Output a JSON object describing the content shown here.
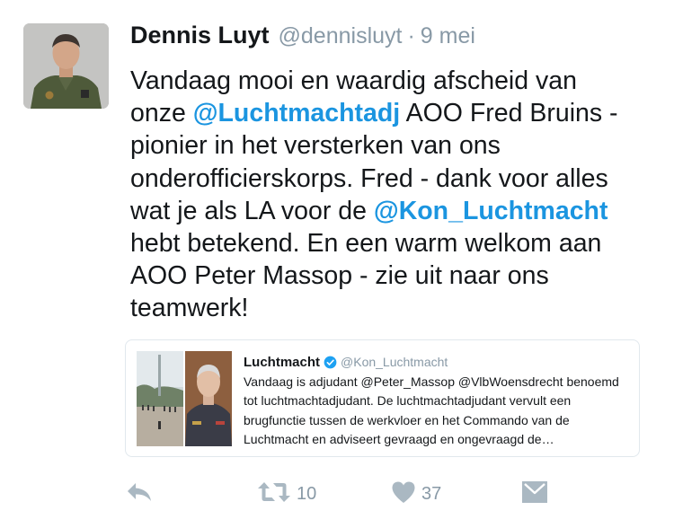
{
  "tweet": {
    "author_name": "Dennis Luyt",
    "author_handle": "@dennisluyt",
    "separator": "·",
    "time": "9 mei",
    "text_lines": [
      [
        {
          "t": "Vandaag mooi en waardig afscheid van"
        }
      ],
      [
        {
          "t": "onze "
        },
        {
          "t": "@Luchtmachtadj",
          "mention": true
        },
        {
          "t": " AOO Fred Bruins -"
        }
      ],
      [
        {
          "t": "pionier in het versterken van ons"
        }
      ],
      [
        {
          "t": "onderofficierskorps. Fred - dank voor alles"
        }
      ],
      [
        {
          "t": "wat je als LA voor de "
        },
        {
          "t": "@Kon_Luchtmacht",
          "mention": true
        }
      ],
      [
        {
          "t": "hebt betekend. En een warm welkom aan"
        }
      ],
      [
        {
          "t": "AOO Peter Massop - zie uit naar ons"
        }
      ],
      [
        {
          "t": "teamwerk!"
        }
      ]
    ],
    "mention_color": "#1b95e0"
  },
  "quoted_tweet": {
    "author_name": "Luchtmacht",
    "author_handle": "@Kon_Luchtmacht",
    "verified_icon": "verified-badge-icon",
    "text_lines": [
      "Vandaag is adjudant @Peter_Massop @VlbWoensdrecht benoemd",
      "tot luchtmachtadjudant. De luchtmachtadjudant vervult een",
      "brugfunctie tussen de werkvloer en het Commando van de",
      "Luchtmacht en adviseert gevraagd en ongevraagd de…"
    ]
  },
  "actions": {
    "reply_icon": "reply-icon",
    "retweet_icon": "retweet-icon",
    "retweet_count": "10",
    "like_icon": "heart-icon",
    "like_count": "37",
    "dm_icon": "direct-message-icon"
  }
}
